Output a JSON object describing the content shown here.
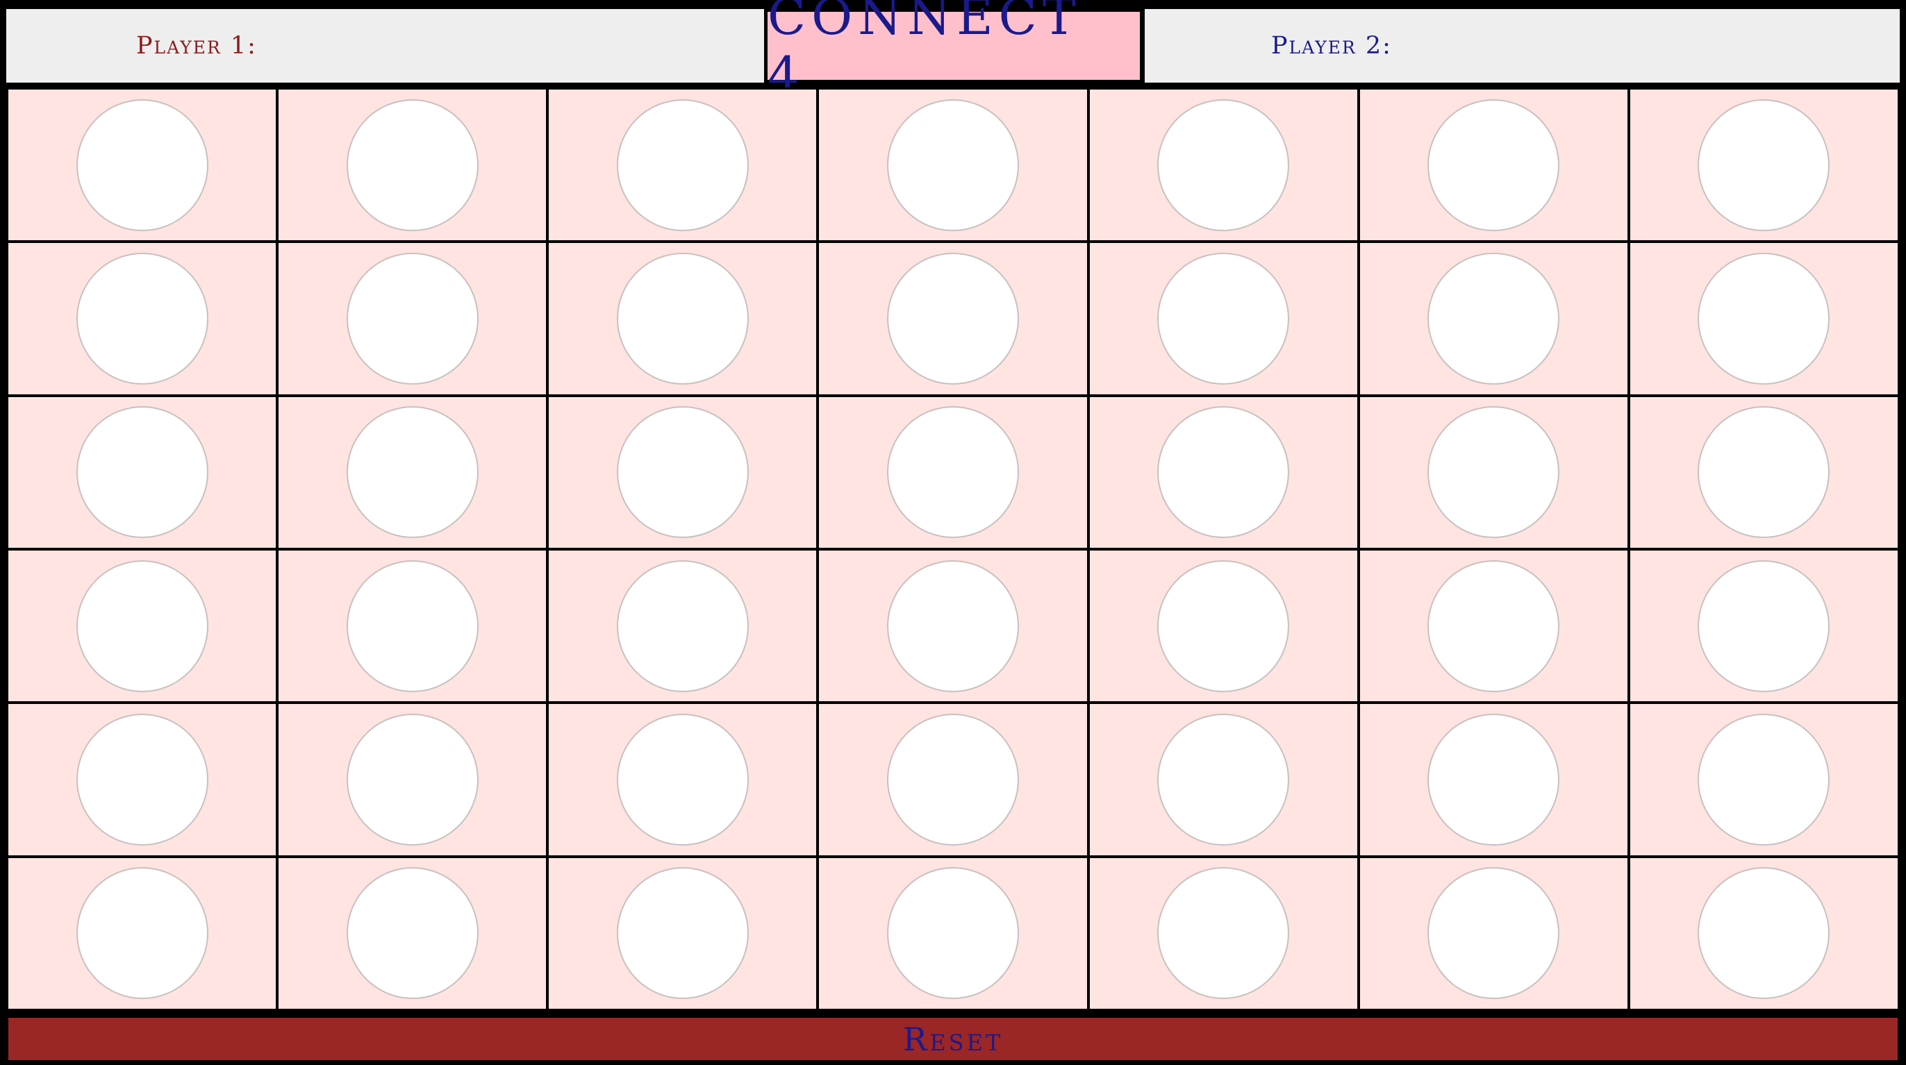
{
  "header": {
    "title": "CONNECT 4",
    "player1_label": "Player 1:",
    "player2_label": "Player 2:"
  },
  "board": {
    "columns": 7,
    "rows": 6,
    "cells": [
      [
        "empty",
        "empty",
        "empty",
        "empty",
        "empty",
        "empty",
        "empty"
      ],
      [
        "empty",
        "empty",
        "empty",
        "empty",
        "empty",
        "empty",
        "empty"
      ],
      [
        "empty",
        "empty",
        "empty",
        "empty",
        "empty",
        "empty",
        "empty"
      ],
      [
        "empty",
        "empty",
        "empty",
        "empty",
        "empty",
        "empty",
        "empty"
      ],
      [
        "empty",
        "empty",
        "empty",
        "empty",
        "empty",
        "empty",
        "empty"
      ],
      [
        "empty",
        "empty",
        "empty",
        "empty",
        "empty",
        "empty",
        "empty"
      ]
    ]
  },
  "reset_label": "Reset",
  "colors": {
    "background": "#000000",
    "player_bar": "#eeeeee",
    "title_box": "#ffc0cb",
    "title_text": "#1a1a8c",
    "player1_text": "#8b1a1a",
    "player2_text": "#1a1a8c",
    "cell": "#ffe4e1",
    "disc_empty": "#ffffff",
    "disc_border": "#c9c0c0",
    "reset_bar": "#9b2626",
    "reset_text": "#1a1a8c"
  }
}
